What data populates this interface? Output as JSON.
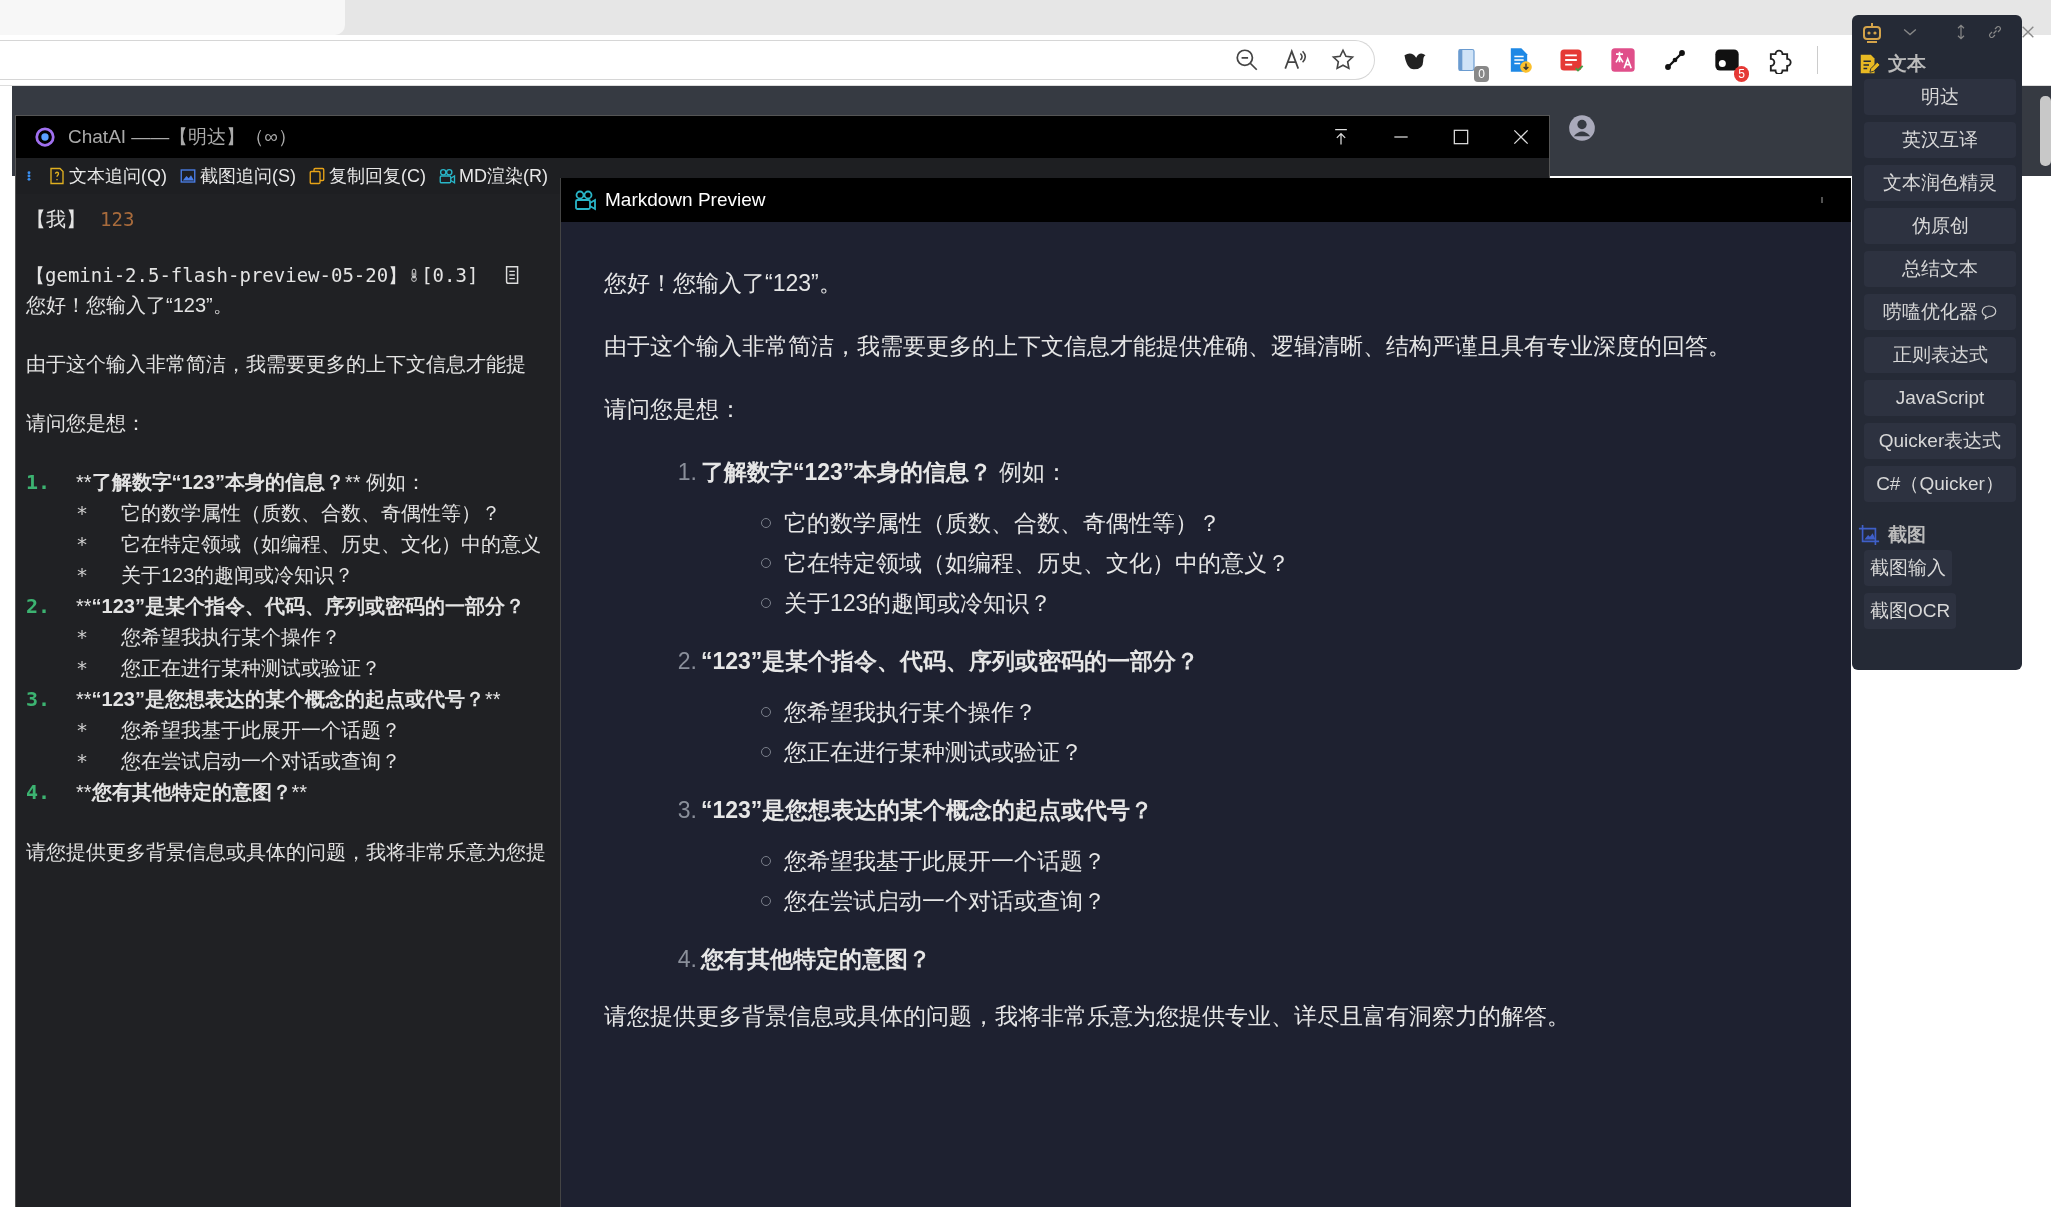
{
  "browser": {
    "toolbar_icons": [
      {
        "kind": "zoom-out"
      },
      {
        "kind": "read-aloud"
      },
      {
        "kind": "star"
      }
    ],
    "extensions": [
      {
        "kind": "bird"
      },
      {
        "kind": "book",
        "badge": "0"
      },
      {
        "kind": "doc-download"
      },
      {
        "kind": "red-note"
      },
      {
        "kind": "translate"
      },
      {
        "kind": "nodes"
      },
      {
        "kind": "black-square",
        "badge": "5"
      },
      {
        "kind": "puzzle"
      }
    ]
  },
  "chat_window": {
    "title": "ChatAI ——【明达】（∞）",
    "toolbar": [
      {
        "kind": "text-followup",
        "label": "文本追问(Q)"
      },
      {
        "kind": "screenshot-followup",
        "label": "截图追问(S)"
      },
      {
        "kind": "copy",
        "label": "复制回复(C)"
      },
      {
        "kind": "md-render",
        "label": "MD渲染(R)"
      }
    ],
    "user_label": "【我】",
    "user_text": "123",
    "model_label": "【gemini-2.5-flash-preview-05-20】",
    "temperature": "[0.3]",
    "lines": [
      {
        "kind": "para",
        "text": "您好！您输入了“123”。"
      },
      {
        "kind": "para",
        "text": "由于这个输入非常简洁，我需要更多的上下文信息才能提"
      },
      {
        "kind": "para",
        "text": "请问您是想："
      },
      {
        "kind": "item",
        "number": "1.",
        "open": "**",
        "bold": "了解数字“123”本身的信息？",
        "rest": "** 例如："
      },
      {
        "kind": "sub",
        "bullet": "*",
        "text": "它的数学属性（质数、合数、奇偶性等）？"
      },
      {
        "kind": "sub",
        "bullet": "*",
        "text": "它在特定领域（如编程、历史、文化）中的意义"
      },
      {
        "kind": "sub",
        "bullet": "*",
        "text": "关于123的趣闻或冷知识？"
      },
      {
        "kind": "item",
        "number": "2.",
        "open": "**",
        "bold": "“123”是某个指令、代码、序列或密码的一部分？"
      },
      {
        "kind": "sub",
        "bullet": "*",
        "text": "您希望我执行某个操作？"
      },
      {
        "kind": "sub",
        "bullet": "*",
        "text": "您正在进行某种测试或验证？"
      },
      {
        "kind": "item",
        "number": "3.",
        "open": "**",
        "bold": "“123”是您想表达的某个概念的起点或代号？",
        "rest": "**"
      },
      {
        "kind": "sub",
        "bullet": "*",
        "text": "您希望我基于此展开一个话题？"
      },
      {
        "kind": "sub",
        "bullet": "*",
        "text": "您在尝试启动一个对话或查询？"
      },
      {
        "kind": "item",
        "number": "4.",
        "open": "**",
        "bold": "您有其他特定的意图？",
        "rest": "**"
      },
      {
        "kind": "para",
        "text": "请您提供更多背景信息或具体的问题，我将非常乐意为您提"
      }
    ]
  },
  "preview": {
    "title": "Markdown Preview",
    "blocks": [
      {
        "kind": "para",
        "text": "您好！您输入了“123”。"
      },
      {
        "kind": "para",
        "text": "由于这个输入非常简洁，我需要更多的上下文信息才能提供准确、逻辑清晰、结构严谨且具有专业深度的回答。"
      },
      {
        "kind": "para",
        "text": "请问您是想："
      },
      {
        "kind": "item",
        "number": "1.",
        "bold": "了解数字“123”本身的信息？",
        "rest": " 例如："
      },
      {
        "kind": "sub",
        "text": "它的数学属性（质数、合数、奇偶性等）？"
      },
      {
        "kind": "sub",
        "text": "它在特定领域（如编程、历史、文化）中的意义？"
      },
      {
        "kind": "sub",
        "text": "关于123的趣闻或冷知识？"
      },
      {
        "kind": "item",
        "number": "2.",
        "bold": "“123”是某个指令、代码、序列或密码的一部分？"
      },
      {
        "kind": "sub",
        "text": "您希望我执行某个操作？"
      },
      {
        "kind": "sub",
        "text": "您正在进行某种测试或验证？"
      },
      {
        "kind": "item",
        "number": "3.",
        "bold": "“123”是您想表达的某个概念的起点或代号？"
      },
      {
        "kind": "sub",
        "text": "您希望我基于此展开一个话题？"
      },
      {
        "kind": "sub",
        "text": "您在尝试启动一个对话或查询？"
      },
      {
        "kind": "item",
        "number": "4.",
        "bold": "您有其他特定的意图？"
      },
      {
        "kind": "para",
        "text": "请您提供更多背景信息或具体的问题，我将非常乐意为您提供专业、详尽且富有洞察力的解答。"
      }
    ]
  },
  "quicker_panel": {
    "sections": [
      {
        "kind": "text",
        "title": "文本",
        "buttons": [
          {
            "kind": "plain",
            "label": "明达"
          },
          {
            "kind": "plain",
            "label": "英汉互译"
          },
          {
            "kind": "plain",
            "label": "文本润色精灵"
          },
          {
            "kind": "plain",
            "label": "伪原创"
          },
          {
            "kind": "plain",
            "label": "总结文本"
          },
          {
            "kind": "chat",
            "label": "唠嗑优化器"
          },
          {
            "kind": "plain",
            "label": "正则表达式"
          },
          {
            "kind": "plain",
            "label": "JavaScript"
          },
          {
            "kind": "plain",
            "label": "Quicker表达式"
          },
          {
            "kind": "plain",
            "label": "C#（Quicker）"
          }
        ]
      },
      {
        "kind": "screenshot",
        "title": "截图",
        "buttons": [
          {
            "kind": "plain",
            "label": "截图输入"
          },
          {
            "kind": "plain",
            "label": "截图OCR"
          }
        ]
      }
    ]
  }
}
